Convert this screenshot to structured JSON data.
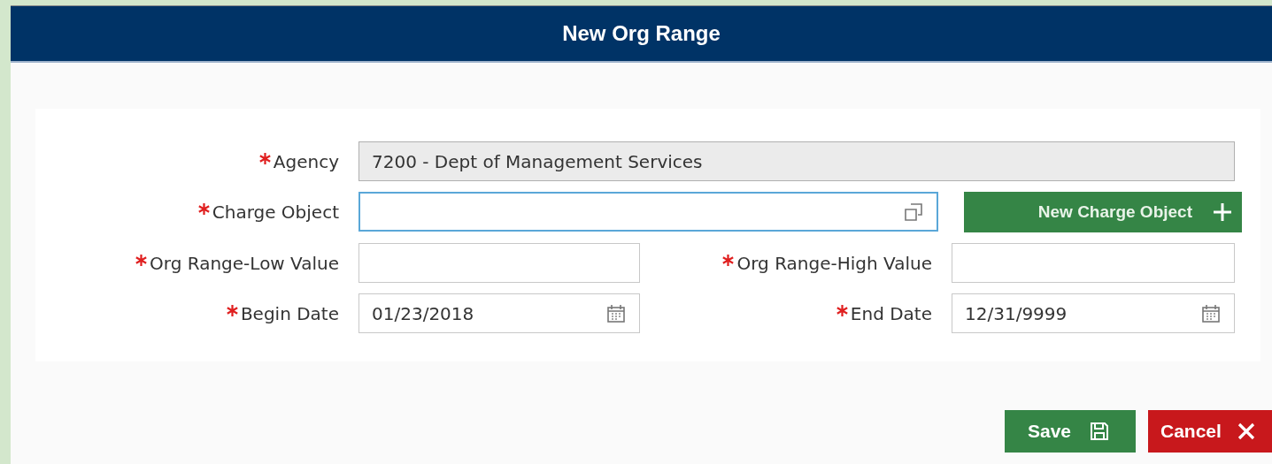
{
  "dialog": {
    "title": "New Org Range"
  },
  "fields": [
    {
      "kind": "readonly",
      "label": "Agency",
      "required": true,
      "value": "7200 - Dept of Management Services",
      "focused": false
    },
    {
      "kind": "lookup",
      "label": "Charge Object",
      "required": true,
      "focused": true,
      "action": {
        "label": "New Charge Object"
      }
    },
    {
      "kind": "text",
      "label": "Org Range-Low Value",
      "required": true,
      "focused": false
    },
    {
      "kind": "text",
      "label": "Org Range-High Value",
      "required": true,
      "focused": false
    },
    {
      "kind": "date",
      "label": "Begin Date",
      "required": true,
      "value": "01/23/2018",
      "focused": false
    },
    {
      "kind": "date",
      "label": "End Date",
      "required": true,
      "value": "12/31/9999",
      "focused": false
    }
  ],
  "buttons": [
    {
      "kind": "save",
      "label": "Save"
    },
    {
      "kind": "cancel",
      "label": "Cancel"
    }
  ]
}
